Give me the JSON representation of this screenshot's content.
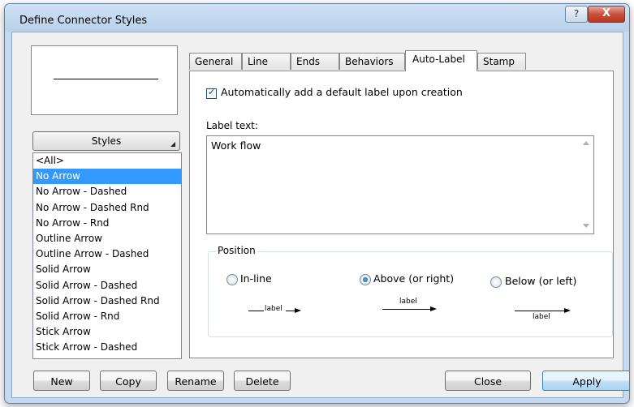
{
  "window": {
    "title": "Define Connector Styles",
    "help_label": "?",
    "close_label": "X"
  },
  "styles": {
    "button_label": "Styles",
    "items": [
      {
        "label": "<All>",
        "selected": false
      },
      {
        "label": "No Arrow",
        "selected": true
      },
      {
        "label": "No Arrow - Dashed",
        "selected": false
      },
      {
        "label": "No Arrow - Dashed Rnd",
        "selected": false
      },
      {
        "label": "No Arrow - Rnd",
        "selected": false
      },
      {
        "label": "Outline Arrow",
        "selected": false
      },
      {
        "label": "Outline Arrow - Dashed",
        "selected": false
      },
      {
        "label": "Solid Arrow",
        "selected": false
      },
      {
        "label": "Solid Arrow - Dashed",
        "selected": false
      },
      {
        "label": "Solid Arrow - Dashed Rnd",
        "selected": false
      },
      {
        "label": "Solid Arrow - Rnd",
        "selected": false
      },
      {
        "label": "Stick Arrow",
        "selected": false
      },
      {
        "label": "Stick Arrow - Dashed",
        "selected": false
      }
    ]
  },
  "tabs": [
    {
      "label": "General",
      "active": false
    },
    {
      "label": "Line",
      "active": false
    },
    {
      "label": "Ends",
      "active": false
    },
    {
      "label": "Behaviors",
      "active": false
    },
    {
      "label": "Auto-Label",
      "active": true
    },
    {
      "label": "Stamp",
      "active": false
    }
  ],
  "auto_label": {
    "checkbox_label": "Automatically add a default label upon creation",
    "checked": true,
    "label_text_caption": "Label text:",
    "label_text_value": "Work flow",
    "position": {
      "legend": "Position",
      "options": [
        {
          "label": "In-line",
          "selected": false,
          "example_text": "label"
        },
        {
          "label": "Above (or right)",
          "selected": true,
          "example_text": "label"
        },
        {
          "label": "Below (or left)",
          "selected": false,
          "example_text": "label"
        }
      ]
    }
  },
  "buttons": {
    "new": "New",
    "copy": "Copy",
    "rename": "Rename",
    "delete": "Delete",
    "close": "Close",
    "apply": "Apply"
  },
  "colors": {
    "selection": "#3399ff",
    "frame": "#c5daf0",
    "close_button": "#c9513e"
  }
}
